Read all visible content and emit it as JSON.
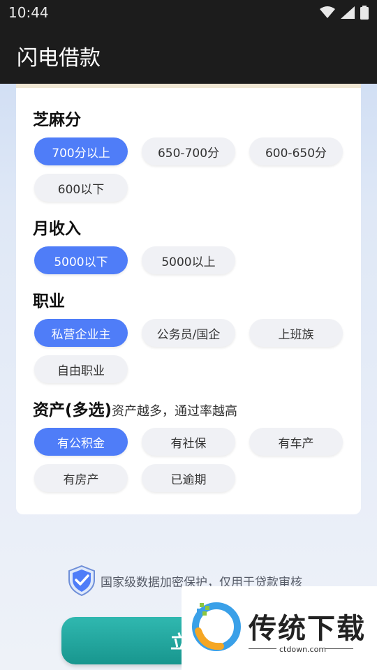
{
  "status_bar": {
    "time": "10:44"
  },
  "app_bar": {
    "title": "闪电借款"
  },
  "sections": {
    "sesame": {
      "title": "芝麻分",
      "options": [
        "700分以上",
        "650-700分",
        "600-650分",
        "600以下"
      ],
      "selected": "700分以上"
    },
    "income": {
      "title": "月收入",
      "options": [
        "5000以下",
        "5000以上"
      ],
      "selected": "5000以下"
    },
    "occupation": {
      "title": "职业",
      "options": [
        "私营企业主",
        "公务员/国企",
        "上班族",
        "自由职业"
      ],
      "selected": "私营企业主"
    },
    "assets": {
      "title": "资产(多选)",
      "subtitle": "资产越多，通过率越高",
      "options": [
        "有公积金",
        "有社保",
        "有车产",
        "有房产",
        "已逾期"
      ],
      "selected": "有公积金"
    }
  },
  "security_note": "国家级数据加密保护，仅用于贷款审核",
  "submit_button": "立即",
  "watermark": {
    "brand": "传统下载",
    "url": "ctdown.com"
  },
  "colors": {
    "accent": "#4f7df8",
    "button": "#1fa49c",
    "chip_bg": "#f0f1f5"
  }
}
